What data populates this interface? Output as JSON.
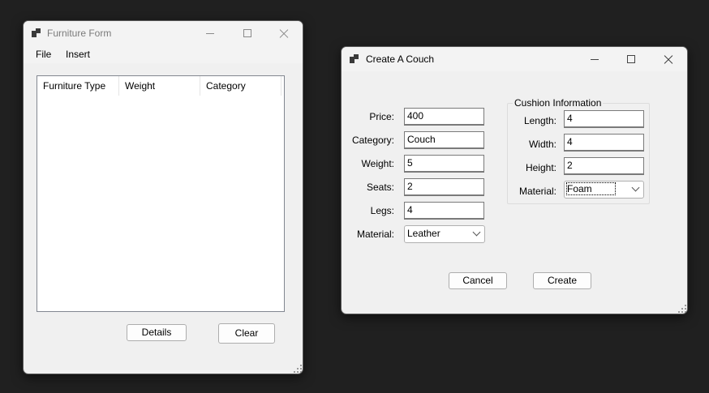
{
  "furniture_form": {
    "title": "Furniture Form",
    "icon": "app-window-icon",
    "menu": [
      "File",
      "Insert"
    ],
    "list_columns": [
      "Furniture Type",
      "Weight",
      "Category"
    ],
    "rows": [],
    "details_button": "Details",
    "clear_button": "Clear"
  },
  "couch_dialog": {
    "title": "Create A Couch",
    "icon": "app-window-icon",
    "fields": {
      "price": {
        "label": "Price:",
        "value": "400"
      },
      "category": {
        "label": "Category:",
        "value": "Couch"
      },
      "weight": {
        "label": "Weight:",
        "value": "5"
      },
      "seats": {
        "label": "Seats:",
        "value": "2"
      },
      "legs": {
        "label": "Legs:",
        "value": "4"
      },
      "material": {
        "label": "Material:",
        "value": "Leather"
      }
    },
    "cushion": {
      "title": "Cushion Information",
      "length": {
        "label": "Length:",
        "value": "4"
      },
      "width": {
        "label": "Width:",
        "value": "4"
      },
      "height": {
        "label": "Height:",
        "value": "2"
      },
      "material": {
        "label": "Material:",
        "value": "Foam"
      }
    },
    "cancel_button": "Cancel",
    "create_button": "Create"
  }
}
